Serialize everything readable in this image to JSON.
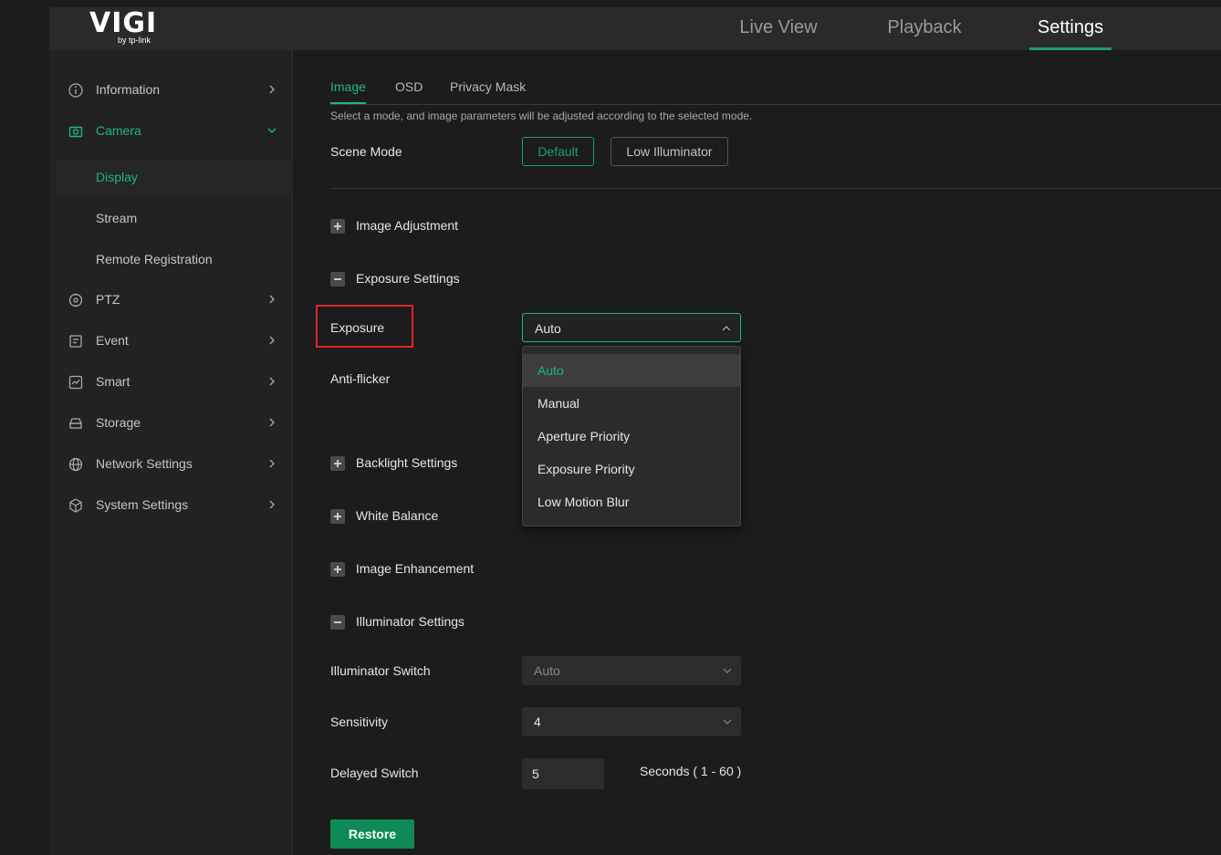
{
  "brand": {
    "name": "VIGI",
    "tagline": "by tp-link"
  },
  "nav": {
    "tabs": [
      {
        "label": "Live View"
      },
      {
        "label": "Playback"
      },
      {
        "label": "Settings"
      }
    ],
    "active": "Settings"
  },
  "sidebar": {
    "items": [
      {
        "label": "Information",
        "icon": "info-icon"
      },
      {
        "label": "Camera",
        "icon": "camera-icon",
        "expanded": true
      },
      {
        "label": "PTZ",
        "icon": "ptz-icon"
      },
      {
        "label": "Event",
        "icon": "event-icon"
      },
      {
        "label": "Smart",
        "icon": "smart-icon"
      },
      {
        "label": "Storage",
        "icon": "storage-icon"
      },
      {
        "label": "Network Settings",
        "icon": "globe-icon"
      },
      {
        "label": "System Settings",
        "icon": "system-icon"
      }
    ],
    "camera_sub": [
      {
        "label": "Display",
        "active": true
      },
      {
        "label": "Stream"
      },
      {
        "label": "Remote Registration"
      }
    ]
  },
  "tabs": [
    {
      "label": "Image"
    },
    {
      "label": "OSD"
    },
    {
      "label": "Privacy Mask"
    }
  ],
  "active_tab": "Image",
  "hint": "Select a mode, and image parameters will be adjusted according to the selected mode.",
  "scene_mode": {
    "label": "Scene Mode",
    "options": [
      "Default",
      "Low Illuminator"
    ],
    "selected": "Default"
  },
  "sections": {
    "image_adjustment": "Image Adjustment",
    "exposure_settings": "Exposure Settings",
    "backlight_settings": "Backlight Settings",
    "white_balance": "White Balance",
    "image_enhancement": "Image Enhancement",
    "illuminator_settings": "Illuminator Settings"
  },
  "exposure": {
    "label": "Exposure",
    "value": "Auto",
    "options": [
      "Auto",
      "Manual",
      "Aperture Priority",
      "Exposure Priority",
      "Low Motion Blur"
    ],
    "selected_index": 0
  },
  "anti_flicker": {
    "label": "Anti-flicker"
  },
  "illuminator": {
    "switch": {
      "label": "Illuminator Switch",
      "value": "Auto"
    },
    "sensitivity": {
      "label": "Sensitivity",
      "value": "4"
    },
    "delayed_switch": {
      "label": "Delayed Switch",
      "value": "5",
      "unit": "Seconds ( 1 - 60 )"
    }
  },
  "actions": {
    "restore": "Restore"
  },
  "colors": {
    "accent": "#1fb77c",
    "highlight_border": "#e0262a",
    "background": "#1c1c1c",
    "panel": "#222222"
  }
}
